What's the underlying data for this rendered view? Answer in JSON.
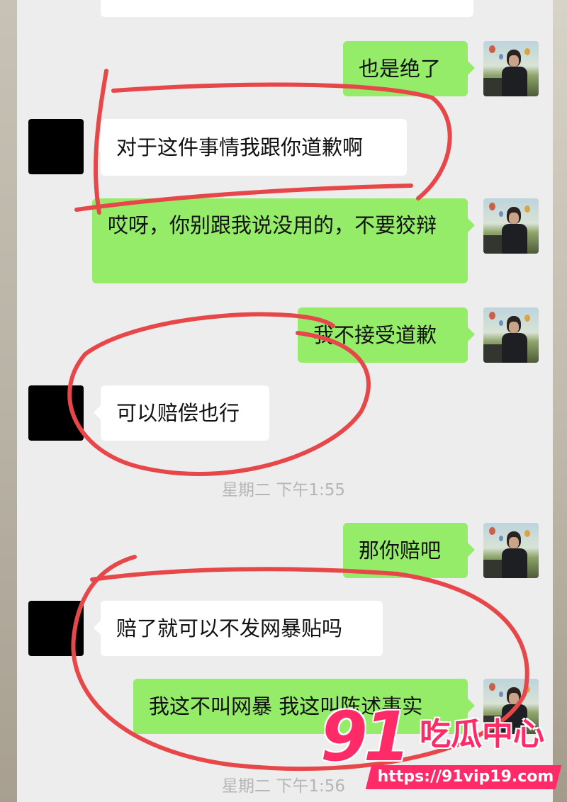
{
  "messages": [
    {
      "side": "right",
      "text": "也是绝了"
    },
    {
      "side": "left",
      "text": "对于这件事情我跟你道歉啊"
    },
    {
      "side": "right",
      "text": "哎呀，你别跟我说没用的，不要狡辩"
    },
    {
      "side": "right",
      "text": "我不接受道歉"
    },
    {
      "side": "left",
      "text": "可以赔偿也行"
    },
    {
      "side": "right",
      "text": "那你赔吧"
    },
    {
      "side": "left",
      "text": "赔了就可以不发网暴贴吗"
    },
    {
      "side": "right",
      "text": "我这不叫网暴 我这叫陈述事实"
    }
  ],
  "timestamps": [
    "星期二 下午1:55",
    "星期二 下午1:56"
  ],
  "colors": {
    "chat_bg": "#ededed",
    "sent_bubble": "#95ec69",
    "received_bubble": "#ffffff",
    "annotation": "#e8474a",
    "watermark": "#ff2a68"
  },
  "watermark": {
    "number": "91",
    "name": "吃瓜中心",
    "url": "https://91vip19.com"
  }
}
